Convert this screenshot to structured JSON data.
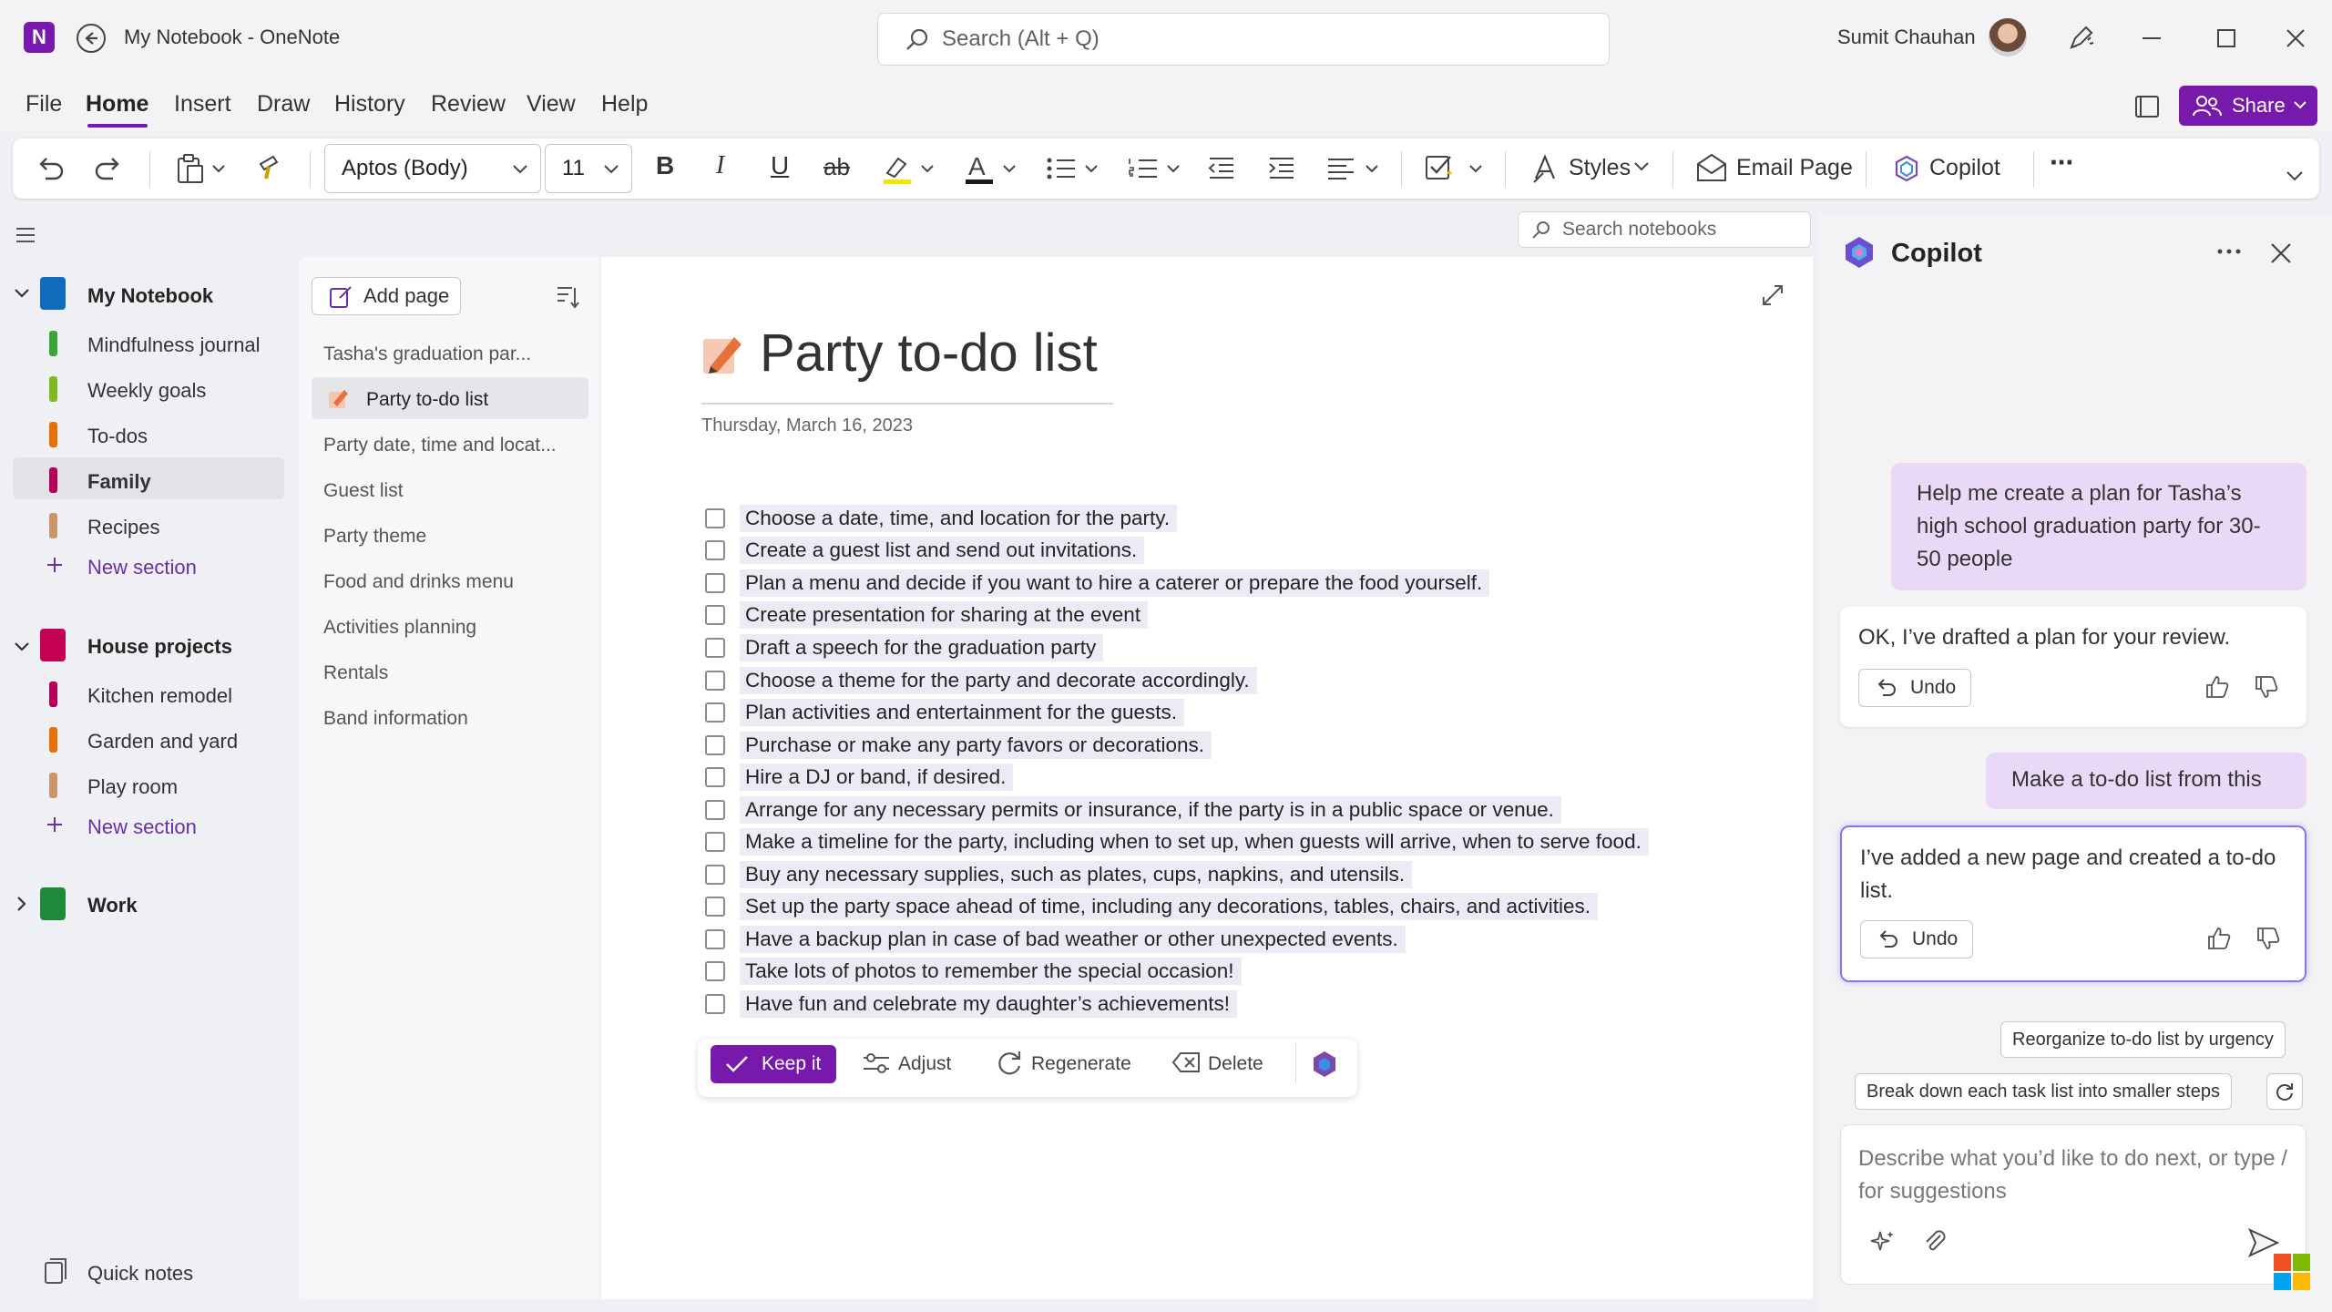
{
  "window": {
    "app_icon": "onenote-logo",
    "title": "My Notebook - OneNote",
    "user_name": "Sumit Chauhan",
    "search_placeholder": "Search (Alt + Q)"
  },
  "menu": {
    "tabs": [
      "File",
      "Home",
      "Insert",
      "Draw",
      "History",
      "Review",
      "View",
      "Help"
    ],
    "active": "Home",
    "share_label": "Share"
  },
  "ribbon": {
    "font_name": "Aptos (Body)",
    "font_size": "11",
    "styles_label": "Styles",
    "email_label": "Email Page",
    "copilot_label": "Copilot",
    "bold_label": "B",
    "italic_label": "I",
    "underline_label": "U",
    "strike_label": "ab",
    "font_color_label": "A",
    "more_label": "···"
  },
  "nav": {
    "search_notebooks": "Search notebooks",
    "notebooks": [
      {
        "name": "My Notebook",
        "color": "#0f6cbd",
        "expanded": true,
        "sections": [
          {
            "name": "Mindfulness journal",
            "color": "#3aa63a"
          },
          {
            "name": "Weekly goals",
            "color": "#7fba1e"
          },
          {
            "name": "To-dos",
            "color": "#e8700a"
          },
          {
            "name": "Family",
            "color": "#b4005a",
            "selected": true
          },
          {
            "name": "Recipes",
            "color": "#c9956a"
          }
        ]
      },
      {
        "name": "House projects",
        "color": "#c30052",
        "expanded": true,
        "sections": [
          {
            "name": "Kitchen remodel",
            "color": "#b4005a"
          },
          {
            "name": "Garden and yard",
            "color": "#e8700a"
          },
          {
            "name": "Play room",
            "color": "#c9956a"
          }
        ]
      },
      {
        "name": "Work",
        "color": "#1e8a3c",
        "expanded": false,
        "sections": []
      }
    ],
    "new_section_label": "New section",
    "quick_notes": "Quick notes"
  },
  "pages": {
    "add_page_label": "Add page",
    "items": [
      "Tasha's graduation par...",
      "Party to-do list",
      "Party date, time and locat...",
      "Guest list",
      "Party theme",
      "Food and drinks menu",
      "Activities planning",
      "Rentals",
      "Band information"
    ],
    "selected_index": 1
  },
  "page": {
    "title": "Party to-do list",
    "date": "Thursday, March 16, 2023",
    "todos": [
      "Choose a date, time, and location for the party.",
      "Create a guest list and send out invitations.",
      "Plan a menu and decide if you want to hire a caterer or prepare the food yourself.",
      "Create presentation for sharing at the event",
      "Draft a speech for the graduation party",
      "Choose a theme for the party and decorate accordingly.",
      "Plan activities and entertainment for the guests.",
      "Purchase or make any party favors or decorations.",
      "Hire a DJ or band, if desired.",
      "Arrange for any necessary permits or insurance, if the party is in a public space or venue.",
      "Make a timeline for the party, including when to set up, when guests will arrive, when to serve food.",
      "Buy any necessary supplies, such as plates, cups, napkins, and utensils.",
      "Set up the party space ahead of time, including any decorations, tables, chairs, and activities.",
      "Have a backup plan in case of bad weather or other unexpected events.",
      "Take lots of photos to remember the special occasion!",
      "Have fun and celebrate my daughter’s achievements!"
    ],
    "actions": {
      "keep": "Keep it",
      "adjust": "Adjust",
      "regenerate": "Regenerate",
      "delete": "Delete"
    }
  },
  "copilot": {
    "title": "Copilot",
    "messages": [
      {
        "role": "user",
        "text": "Help me create a plan for Tasha’s high school graduation party for 30-50 people"
      },
      {
        "role": "ai",
        "text": "OK, I’ve drafted a plan for your review.",
        "undo": "Undo"
      },
      {
        "role": "user",
        "text": "Make a to-do list from this"
      },
      {
        "role": "ai",
        "text": "I’ve added a new page and created a to-do list.",
        "undo": "Undo"
      }
    ],
    "suggestions": [
      "Reorganize to-do list by urgency",
      "Break down each task list into smaller steps"
    ],
    "input_placeholder": "Describe what you’d like to do next, or type / for suggestions"
  },
  "colors": {
    "accent": "#7719aa",
    "todo_highlight": "#ebebf5",
    "user_bubble": "#ead9f6"
  }
}
